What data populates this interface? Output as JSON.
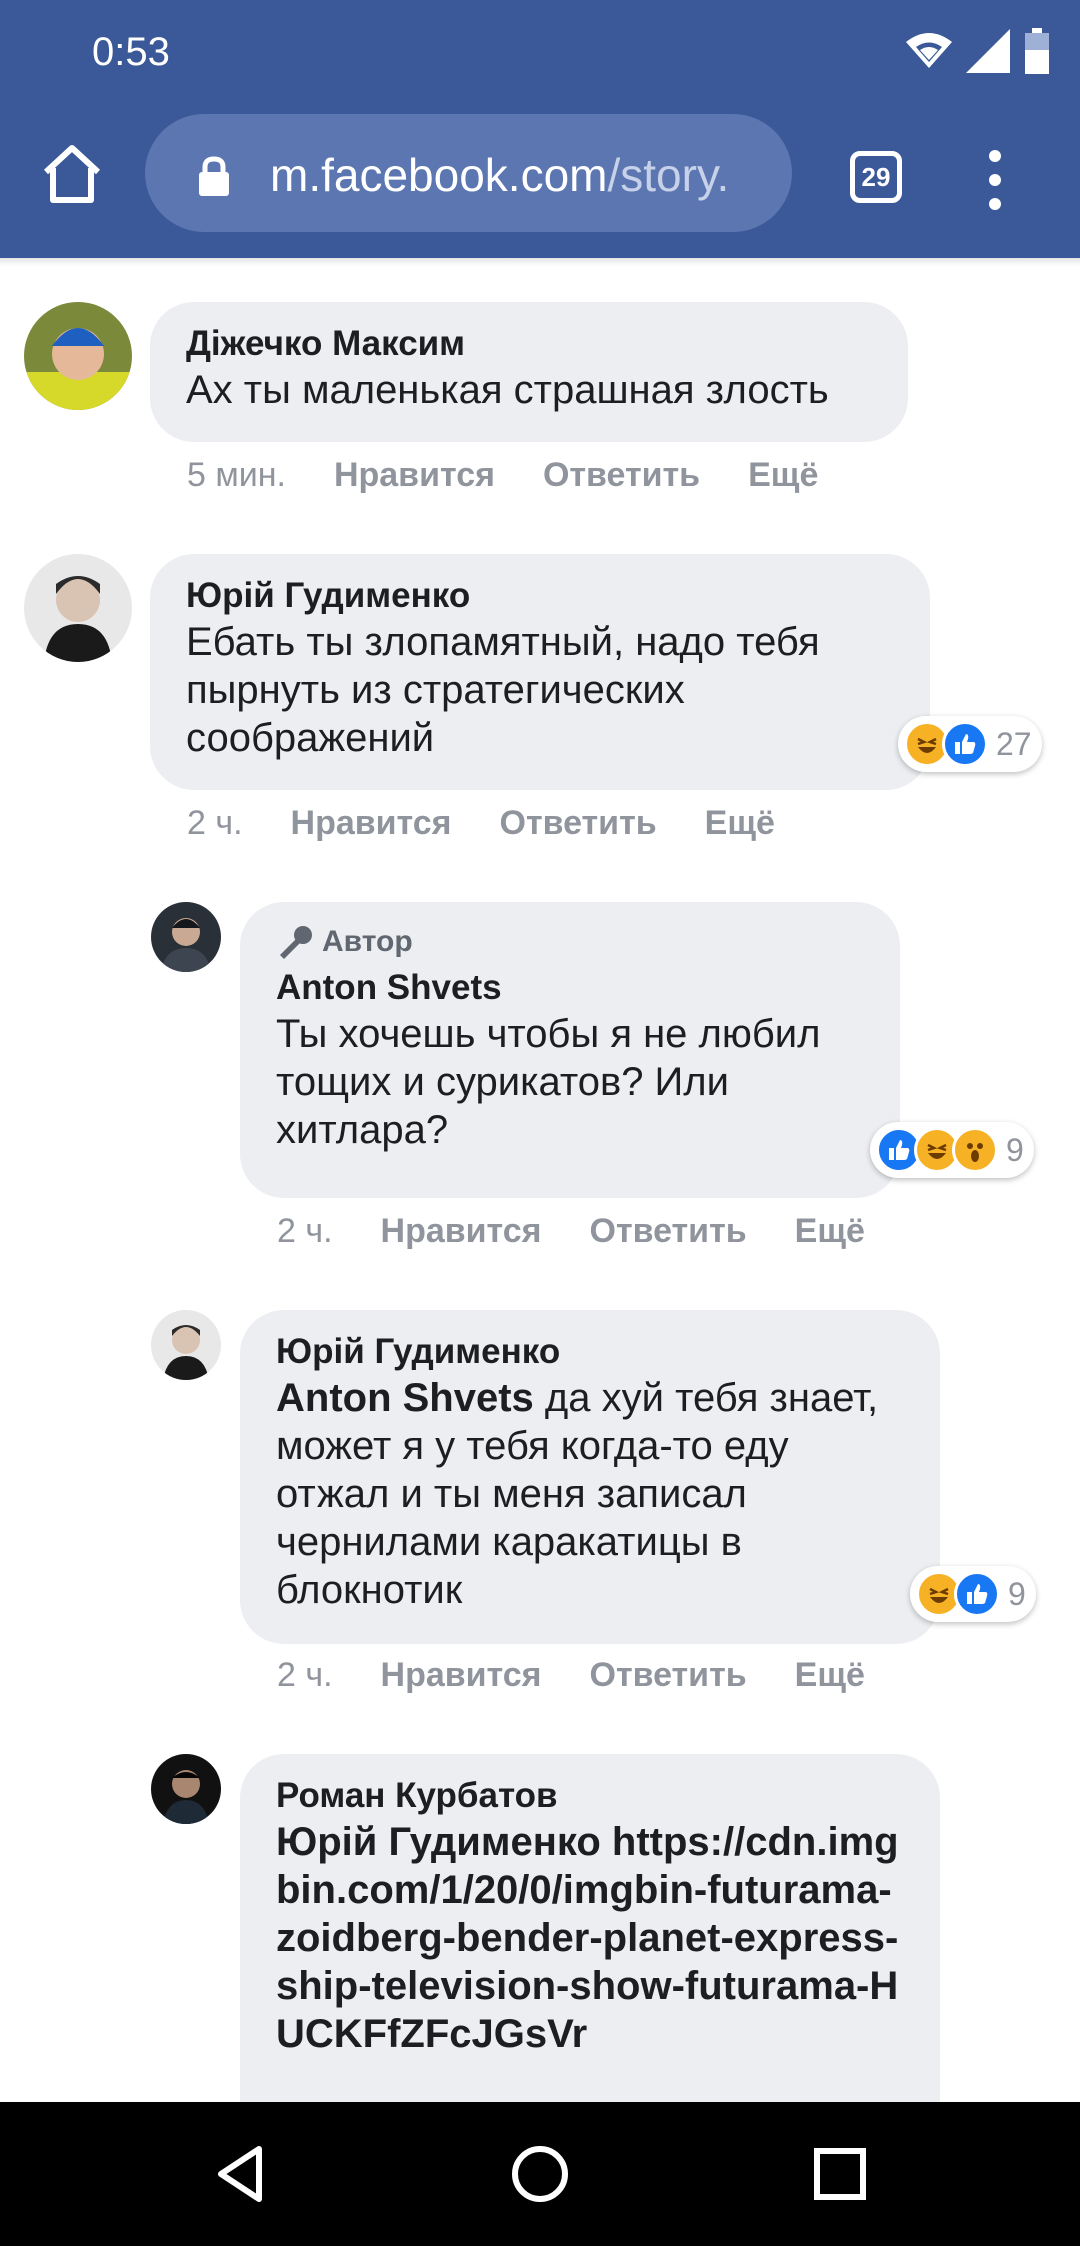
{
  "status": {
    "time": "0:53"
  },
  "browser": {
    "url_domain": "m.facebook.com",
    "url_path": "/story.",
    "tab_count": "29"
  },
  "labels": {
    "like": "Нравится",
    "reply": "Ответить",
    "more": "Ещё"
  },
  "comments": [
    {
      "author": "Діжечко Максим",
      "text": "Ах ты маленькая страшная злость",
      "time": "5 мин."
    },
    {
      "author": "Юрій Гудименко",
      "text": "Ебать ты злопамятный, надо тебя пырнуть из стратегических соображений",
      "time": "2 ч.",
      "reactions": [
        "haha",
        "like"
      ],
      "reaction_count": "27"
    },
    {
      "badge": "Автор",
      "author": "Anton Shvets",
      "text": "Ты хочешь чтобы я не любил тощих и сурикатов? Или хитлара?",
      "time": "2 ч.",
      "reactions": [
        "like",
        "haha",
        "wow"
      ],
      "reaction_count": "9"
    },
    {
      "author": "Юрій Гудименко",
      "mention": "Anton Shvets",
      "text": " да хуй тебя знает, может я у тебя когда-то еду отжал и ты меня записал чернилами каракатицы в блокнотик",
      "time": "2 ч.",
      "reactions": [
        "haha",
        "like"
      ],
      "reaction_count": "9"
    },
    {
      "author": "Роман Курбатов",
      "mention": "Юрій Гудименко",
      "text": " https://cdn.imgbin.com/1/20/0/imgbin-futurama-zoidberg-bender-planet-express-ship-television-show-futurama-HUCKFfZFcJGsVr"
    }
  ],
  "colors": {
    "brand": "#3b5998",
    "bubble": "#eceef2",
    "like": "#1877f2",
    "haha": "#f7b125"
  }
}
